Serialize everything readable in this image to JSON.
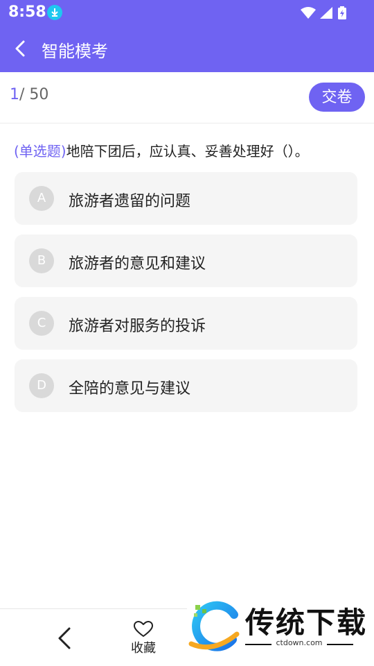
{
  "status_bar": {
    "time": "8:58"
  },
  "app_bar": {
    "title": "智能模考"
  },
  "progress": {
    "current": "1",
    "total": "/ 50"
  },
  "submit_label": "交卷",
  "question": {
    "type": "(单选题)",
    "text": "地陪下团后，应认真、妥善处理好（）。"
  },
  "options": [
    {
      "letter": "A",
      "text": "旅游者遗留的问题"
    },
    {
      "letter": "B",
      "text": "旅游者的意见和建议"
    },
    {
      "letter": "C",
      "text": "旅游者对服务的投诉"
    },
    {
      "letter": "D",
      "text": "全陪的意见与建议"
    }
  ],
  "bottom": {
    "favorite_label": "收藏"
  },
  "watermark": {
    "brand": "传统下载",
    "url": "ctdown.com"
  },
  "colors": {
    "accent": "#6f63f2",
    "option_bg": "#f5f5f5",
    "circle": "#d9d9d9"
  }
}
